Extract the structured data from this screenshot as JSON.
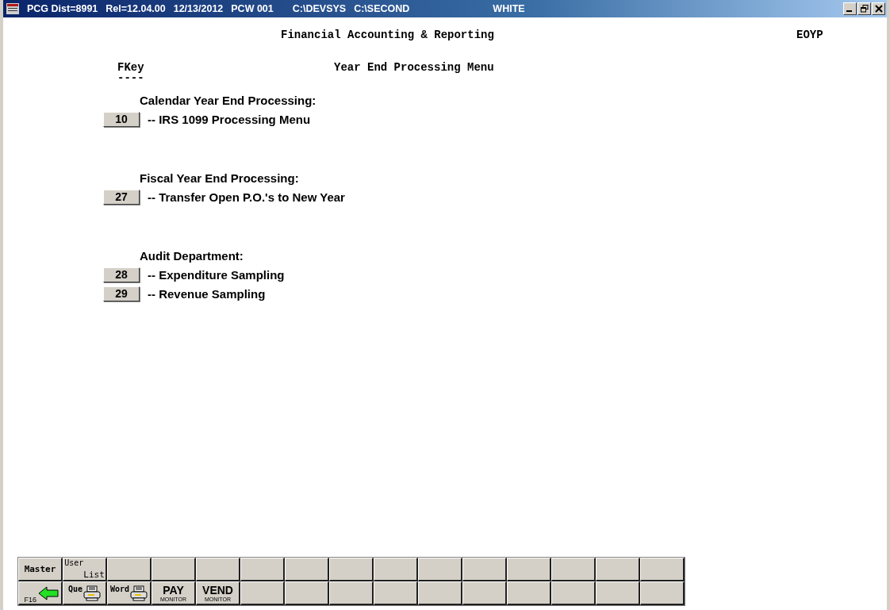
{
  "title_bar": {
    "segments": [
      "PCG Dist=8991",
      "Rel=12.04.00",
      "12/13/2012",
      "PCW 001",
      "C:\\DEVSYS",
      "C:\\SECOND",
      "WHITE"
    ]
  },
  "header": {
    "title": "Financial Accounting & Reporting",
    "code": "EOYP"
  },
  "menu": {
    "key_heading": "FKey",
    "key_rule": "----",
    "title": "Year End Processing Menu"
  },
  "sections": [
    {
      "heading": "Calendar Year End Processing:",
      "items": [
        {
          "key": "10",
          "label": "-- IRS 1099 Processing Menu"
        }
      ]
    },
    {
      "heading": "Fiscal Year End Processing:",
      "items": [
        {
          "key": "27",
          "label": "-- Transfer Open P.O.'s to New Year"
        }
      ]
    },
    {
      "heading": "Audit Department:",
      "items": [
        {
          "key": "28",
          "label": "-- Expenditure Sampling"
        },
        {
          "key": "29",
          "label": "-- Revenue Sampling"
        }
      ]
    }
  ],
  "toolbar": [
    [
      {
        "kind": "text",
        "label": "Master"
      },
      {
        "kind": "userlist",
        "top": "User",
        "bottom": "List"
      },
      {
        "kind": "blank"
      },
      {
        "kind": "blank"
      },
      {
        "kind": "blank"
      },
      {
        "kind": "blank"
      },
      {
        "kind": "blank"
      },
      {
        "kind": "blank"
      },
      {
        "kind": "blank"
      },
      {
        "kind": "blank"
      },
      {
        "kind": "blank"
      },
      {
        "kind": "blank"
      },
      {
        "kind": "blank"
      },
      {
        "kind": "blank"
      },
      {
        "kind": "blank"
      }
    ],
    [
      {
        "kind": "back",
        "label": "F16"
      },
      {
        "kind": "print",
        "label": "Que"
      },
      {
        "kind": "print",
        "label": "Word"
      },
      {
        "kind": "monitor",
        "label": "PAY",
        "sub": "MONITOR"
      },
      {
        "kind": "monitor",
        "label": "VEND",
        "sub": "MONITOR"
      },
      {
        "kind": "blank"
      },
      {
        "kind": "blank"
      },
      {
        "kind": "blank"
      },
      {
        "kind": "blank"
      },
      {
        "kind": "blank"
      },
      {
        "kind": "blank"
      },
      {
        "kind": "blank"
      },
      {
        "kind": "blank"
      },
      {
        "kind": "blank"
      },
      {
        "kind": "blank"
      }
    ]
  ]
}
